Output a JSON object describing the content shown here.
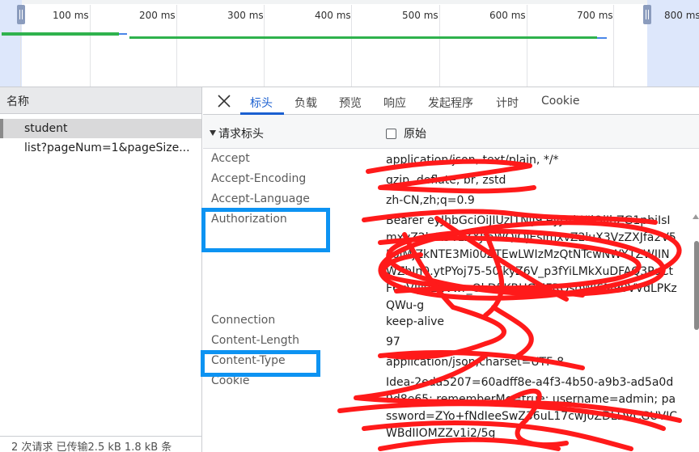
{
  "timeline": {
    "ticks": [
      "100 ms",
      "200 ms",
      "300 ms",
      "400 ms",
      "500 ms",
      "600 ms",
      "700 ms",
      "800 ms"
    ]
  },
  "requests": {
    "header": "名称",
    "items": [
      {
        "name": "student",
        "selected": true
      },
      {
        "name": "list?pageNum=1&pageSize...",
        "selected": false
      }
    ],
    "status": "2 次请求  已传输2.5 kB  1.8 kB 条"
  },
  "detail_tabs": [
    "标头",
    "负载",
    "预览",
    "响应",
    "发起程序",
    "计时",
    "Cookie"
  ],
  "active_tab": "标头",
  "request_headers": {
    "title": "请求标头",
    "raw_label": "原始",
    "rows": [
      {
        "name": "Accept",
        "value": "application/json, text/plain, */*"
      },
      {
        "name": "Accept-Encoding",
        "value": "gzip, deflate, br, zstd"
      },
      {
        "name": "Accept-Language",
        "value": "zh-CN,zh;q=0.9"
      },
      {
        "name": "Authorization",
        "value": "Bearer eyJhbGciOiJIUzI1NiJ9.eyJzdWIiOiJhZG1pbiIsImxvZ2luX3VzZXJfaWQiOjEsImxvZ2luX3VzZXJfa2V5IjoiMjZkNTE3Mi00ZTEwLWIzMzQtNTcwNWY1ZWJINWZhIn0.ytPYoj75-50jkyZ6V_p3fYiLMkXuDFAQ3PoCtF6xVIjiv22Vwr_OkDflKRUGMFRQsdWl6M90VVdLPKzQWu-g"
      },
      {
        "name": "Connection",
        "value": "keep-alive"
      },
      {
        "name": "Content-Length",
        "value": "97"
      },
      {
        "name": "Content-Type",
        "value": "application/json;charset=UTF-8"
      },
      {
        "name": "Cookie",
        "value": "Idea-2eda5207=60adff8e-a4f3-4b50-a9b3-ad5a0d9d8e65; rememberMe=true; username=admin; password=ZYo+fNdIeeSwZ36uL17cwJ0ZDLDVCGUVICWBdIIOMZZv1i2/5g"
      }
    ]
  },
  "colors": {
    "accent": "#1a5fd0",
    "highlight_box": "#0d93f2",
    "scribble": "#ff1a1a",
    "timeline_green": "#2fb24d",
    "timeline_blue": "#4a86e8"
  },
  "icons": {
    "close": "close-icon",
    "collapse": "triangle-down-icon",
    "raw_checkbox": "checkbox-icon"
  }
}
